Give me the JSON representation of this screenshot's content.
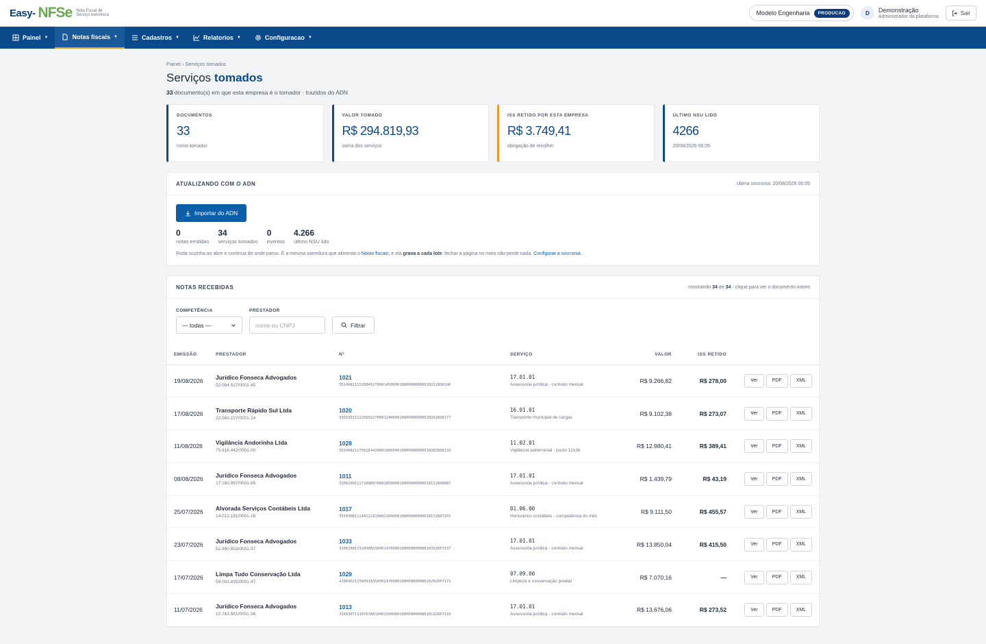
{
  "app": {
    "logo_prefix": "Easy-",
    "logo_main": "NFSe",
    "logo_sub": "Nota Fiscal de Serviço eletrônica"
  },
  "header": {
    "org_name": "Modelo Engenharia",
    "env_badge": "PRODUCAO",
    "avatar_initial": "D",
    "user_name": "Demonstração",
    "user_role": "Administrador da plataforma",
    "logout_label": "Sair"
  },
  "nav": {
    "items": [
      {
        "label": "Painel",
        "icon": "grid-icon"
      },
      {
        "label": "Notas fiscais",
        "icon": "document-icon"
      },
      {
        "label": "Cadastros",
        "icon": "list-icon"
      },
      {
        "label": "Relatorios",
        "icon": "chart-icon"
      },
      {
        "label": "Configuracao",
        "icon": "gear-icon"
      }
    ]
  },
  "page": {
    "breadcrumb": "Painel › Serviços tomados",
    "title_light": "Serviços",
    "title_bold": "tomados",
    "subtitle_count": "33",
    "subtitle_text": "documento(s) em que esta empresa é o tomador · trazidos do ADN"
  },
  "stats": [
    {
      "label": "DOCUMENTOS",
      "value": "33",
      "note": "como tomador"
    },
    {
      "label": "VALOR TOMADO",
      "value": "R$ 294.819,93",
      "note": "soma dos serviços"
    },
    {
      "label": "ISS RETIDO POR ESTA EMPRESA",
      "value": "R$ 3.749,41",
      "note": "obrigação de recolher"
    },
    {
      "label": "ÚLTIMO NSU LIDO",
      "value": "4266",
      "note": "20/08/2026 06:05"
    }
  ],
  "adn": {
    "title": "ATUALIZANDO COM O ADN",
    "last_sync": "última sincronia: 20/08/2026 06:05",
    "import_label": "Importar do ADN",
    "counts": [
      {
        "value": "0",
        "label": "notas emitidas"
      },
      {
        "value": "34",
        "label": "serviços tomados"
      },
      {
        "value": "0",
        "label": "eventos"
      },
      {
        "value": "4.266",
        "label": "último NSU lido"
      }
    ],
    "note_1": "Roda sozinha ao abrir e continua de onde parou. É a mesma varredura que alimenta o ",
    "note_link_1": "Notas fiscais",
    "note_2": ", e ela ",
    "note_bold": "grava a cada lote",
    "note_3": ": fechar a página no meio não perde nada. ",
    "note_link_2": "Configurar a sincronia."
  },
  "received": {
    "title": "NOTAS RECEBIDAS",
    "meta_1": "mostrando ",
    "meta_shown": "34",
    "meta_2": " de ",
    "meta_total": "34",
    "meta_3": " · clique para ver o documento inteiro",
    "filter_comp_label": "COMPETÊNCIA",
    "filter_comp_value": "— todas —",
    "filter_prest_label": "PRESTADOR",
    "filter_prest_placeholder": "nome ou CNPJ",
    "filter_button": "Filtrar",
    "columns": [
      "EMISSÃO",
      "PRESTADOR",
      "Nº",
      "SERVIÇO",
      "VALOR",
      "ISS RETIDO"
    ],
    "action_labels": {
      "ver": "Ver",
      "pdf": "PDF",
      "xml": "XML"
    },
    "rows": [
      {
        "emissao": "19/08/2026",
        "prestador": "Jurídico Fonseca Advogados",
        "cnpj": "52.084.527/0001-45",
        "numero": "1021",
        "chave": "35240821152084527000145000010000000000010212608196",
        "servico_cod": "17.01.01",
        "servico_desc": "Assessoria jurídica - contrato mensal",
        "valor": "R$ 9.266,82",
        "iss": "R$ 278,00"
      },
      {
        "emissao": "17/08/2026",
        "prestador": "Transporte Rápido Sul Ltda",
        "cnpj": "22.560.227/0001-24",
        "numero": "1020",
        "chave": "33033021122560227000124000010000000000010202608177",
        "servico_cod": "16.01.01",
        "servico_desc": "Transporte municipal de cargas",
        "valor": "R$ 9.102,38",
        "iss": "R$ 273,07"
      },
      {
        "emissao": "11/08/2026",
        "prestador": "Vigilância Andorinha Ltda",
        "cnpj": "75.816.442/0001-00",
        "numero": "1028",
        "chave": "35240821175816442000100000010000000000010282608110",
        "servico_cod": "11.02.01",
        "servico_desc": "Vigilância patrimonial - posto 12x36",
        "valor": "R$ 12.980,41",
        "iss": "R$ 389,41"
      },
      {
        "emissao": "08/08/2026",
        "prestador": "Jurídico Fonseca Advogados",
        "cnpj": "17.180.897/0001-85",
        "numero": "1011",
        "chave": "31062001117180897000185000010000000000010112608087",
        "servico_cod": "17.01.01",
        "servico_desc": "Assessoria jurídica - contrato mensal",
        "valor": "R$ 1.439,79",
        "iss": "R$ 43,19"
      },
      {
        "emissao": "25/07/2026",
        "prestador": "Alvorada Serviços Contábeis Ltda",
        "cnpj": "14.012.191/0001-16",
        "numero": "1017",
        "chave": "35503081114012191000116000010000000000010172607255",
        "servico_cod": "01.06.00",
        "servico_desc": "Honorários contábeis - competência do mês",
        "valor": "R$ 9.111,50",
        "iss": "R$ 455,57"
      },
      {
        "emissao": "23/07/2026",
        "prestador": "Jurídico Fonseca Advogados",
        "cnpj": "52.890.653/0001-97",
        "numero": "1033",
        "chave": "31062001152890653000197000010000000000010332607237",
        "servico_cod": "17.01.01",
        "servico_desc": "Assessoria jurídica - contrato mensal",
        "valor": "R$ 13.850,04",
        "iss": "R$ 415,50"
      },
      {
        "emissao": "17/07/2026",
        "prestador": "Limpa Tudo Conservação Ltda",
        "cnpj": "59.091.835/0001-47",
        "numero": "1029",
        "chave": "41069021159091835000147000010000000000010292607172",
        "servico_cod": "07.09.00",
        "servico_desc": "Limpeza e conservação predial",
        "valor": "R$ 7.070,16",
        "iss": "—"
      },
      {
        "emissao": "11/07/2026",
        "prestador": "Jurídico Fonseca Advogados",
        "cnpj": "10.763.881/0001-56",
        "numero": "1013",
        "chave": "31693071110763881000156000010000000000010132607110",
        "servico_cod": "17.01.01",
        "servico_desc": "Assessoria jurídica - contrato mensal",
        "valor": "R$ 13.676,06",
        "iss": "R$ 273,52"
      }
    ]
  }
}
